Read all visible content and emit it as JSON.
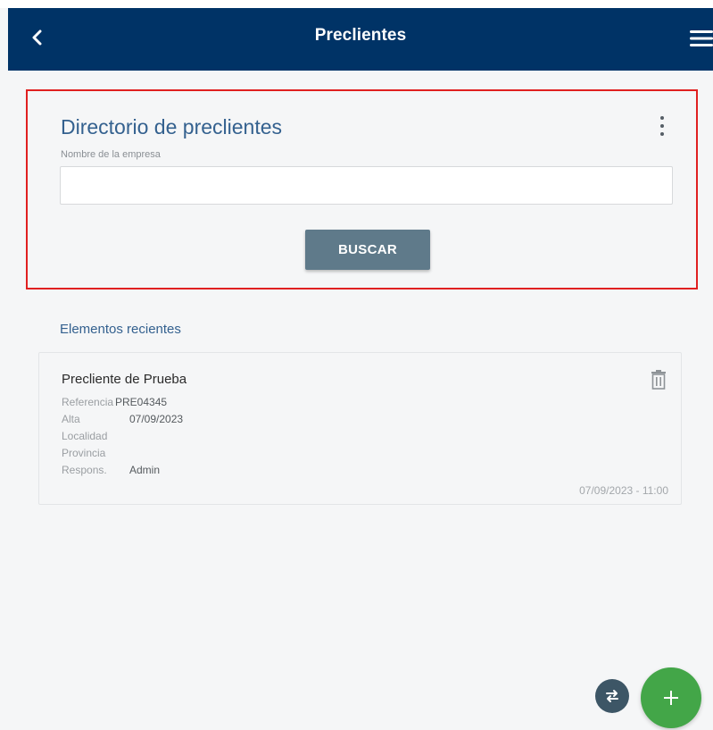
{
  "header": {
    "title": "Preclientes",
    "back_icon": "chevron-left-icon",
    "menu_icon": "hamburger-menu-icon",
    "background": "#003366"
  },
  "search": {
    "title": "Directorio de preclientes",
    "field_label": "Nombre de la empresa",
    "field_value": "",
    "button_label": "BUSCAR",
    "highlight_color": "#e02020"
  },
  "recent": {
    "section_title": "Elementos recientes",
    "items": [
      {
        "name": "Precliente de Prueba",
        "fields": [
          {
            "key": "Referencia",
            "value": "PRE04345"
          },
          {
            "key": "Alta",
            "value": "07/09/2023"
          },
          {
            "key": "Localidad",
            "value": ""
          },
          {
            "key": "Provincia",
            "value": ""
          },
          {
            "key": "Respons.",
            "value": "Admin"
          }
        ],
        "timestamp": "07/09/2023 - 11:00"
      }
    ]
  },
  "fab": {
    "swap_icon": "swap-arrows-icon",
    "add_icon": "plus-icon",
    "add_color": "#43a648"
  }
}
